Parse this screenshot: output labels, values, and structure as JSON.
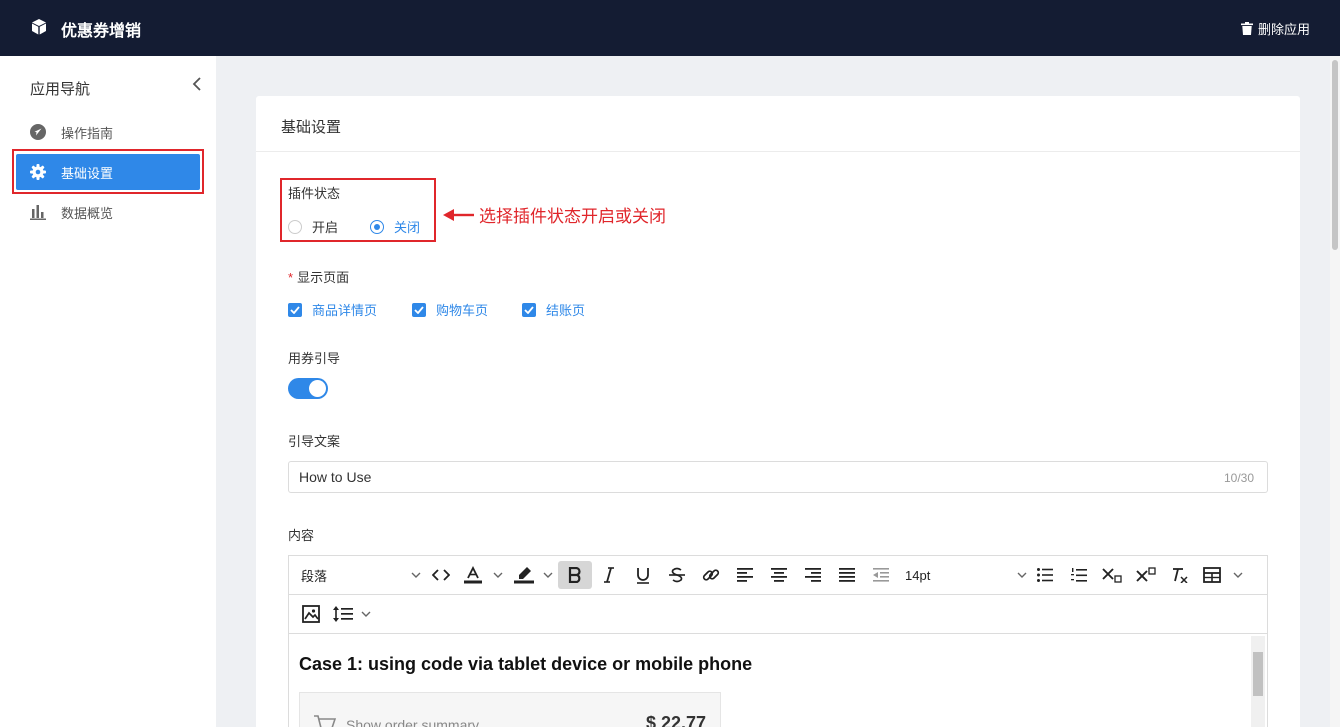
{
  "header": {
    "app_title": "优惠券增销",
    "delete_label": "删除应用"
  },
  "sidebar": {
    "title": "应用导航",
    "items": [
      {
        "label": "操作指南",
        "icon": "navigation-arrow-icon"
      },
      {
        "label": "基础设置",
        "icon": "gear-icon",
        "active": true
      },
      {
        "label": "数据概览",
        "icon": "bar-chart-icon"
      }
    ]
  },
  "card": {
    "title": "基础设置"
  },
  "plugin_status": {
    "label": "插件状态",
    "options": [
      "开启",
      "关闭"
    ],
    "selected": "关闭"
  },
  "annotation": "选择插件状态开启或关闭",
  "display_pages": {
    "label": "显示页面",
    "required": true,
    "options": [
      "商品详情页",
      "购物车页",
      "结账页"
    ]
  },
  "coupon_guide": {
    "label": "用券引导",
    "enabled": true
  },
  "guide_text": {
    "label": "引导文案",
    "value": "How to Use",
    "counter": "10/30"
  },
  "content": {
    "label": "内容",
    "toolbar": {
      "block_format": "段落",
      "font_size": "14pt"
    },
    "body_heading": "Case 1: using code via tablet device or mobile phone",
    "order_summary": "Show order summary",
    "price": "$ 22.77"
  },
  "colors": {
    "header_bg": "#141c33",
    "accent": "#2f88e8",
    "highlight": "#e0262b"
  }
}
